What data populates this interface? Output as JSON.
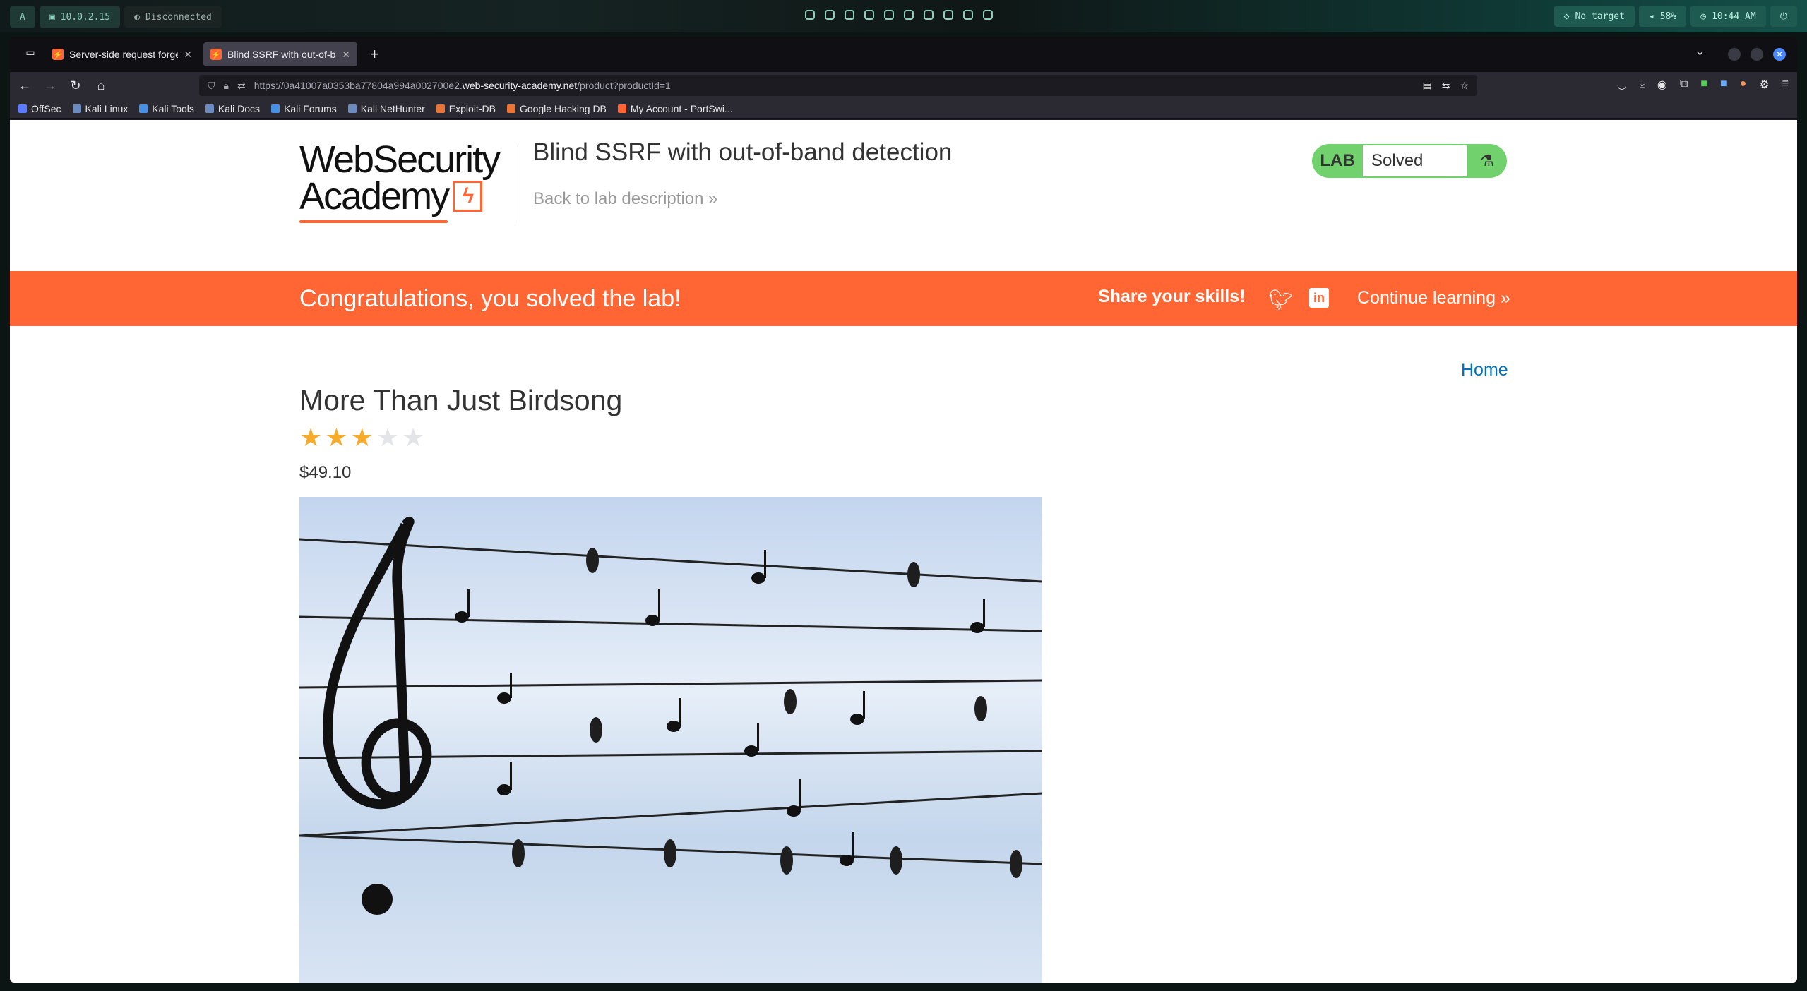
{
  "desktop": {
    "ip_label": "10.0.2.15",
    "vpn_label": "Disconnected",
    "target_label": "No target",
    "volume_label": "58%",
    "clock_label": "10:44 AM"
  },
  "browser": {
    "tabs": [
      {
        "label": "Server-side request forgery"
      },
      {
        "label": "Blind SSRF with out-of-band"
      }
    ],
    "url_prefix": "https://0a41007a0353ba77804a994a002700e2.",
    "url_host": "web-security-academy.net",
    "url_path": "/product?productId=1",
    "bookmarks": [
      {
        "label": "OffSec"
      },
      {
        "label": "Kali Linux"
      },
      {
        "label": "Kali Tools"
      },
      {
        "label": "Kali Docs"
      },
      {
        "label": "Kali Forums"
      },
      {
        "label": "Kali NetHunter"
      },
      {
        "label": "Exploit-DB"
      },
      {
        "label": "Google Hacking DB"
      },
      {
        "label": "My Account - PortSwi..."
      }
    ]
  },
  "page": {
    "logo_line1": "WebSecurity",
    "logo_line2": "Academy",
    "lab_title": "Blind SSRF with out-of-band detection",
    "back_link": "Back to lab description",
    "lab_badge_label": "LAB",
    "lab_status": "Solved",
    "banner_text": "Congratulations, you solved the lab!",
    "share_text": "Share your skills!",
    "continue_text": "Continue learning",
    "home_link": "Home",
    "product_title": "More Than Just Birdsong",
    "rating": 3,
    "rating_max": 5,
    "price": "$49.10"
  },
  "colors": {
    "accent": "#ff6633",
    "lab_green": "#70d16d",
    "link_blue": "#0071bc",
    "star_on": "#f6ab2c",
    "star_off": "#e3e5e8"
  }
}
